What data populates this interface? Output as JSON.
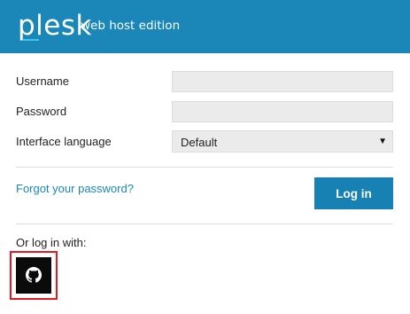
{
  "header": {
    "logo_text": "plesk",
    "edition": "web host edition"
  },
  "form": {
    "username_label": "Username",
    "username_value": "",
    "password_label": "Password",
    "password_value": "",
    "language_label": "Interface language",
    "language_value": "Default"
  },
  "actions": {
    "forgot_link": "Forgot your password?",
    "login_button": "Log in"
  },
  "alt_login": {
    "label": "Or log in with:",
    "providers": [
      {
        "icon": "github-icon"
      }
    ]
  },
  "colors": {
    "header_bg": "#1b87b8",
    "accent": "#1781b4",
    "link": "#1b87b8",
    "highlight": "#e21b23"
  }
}
